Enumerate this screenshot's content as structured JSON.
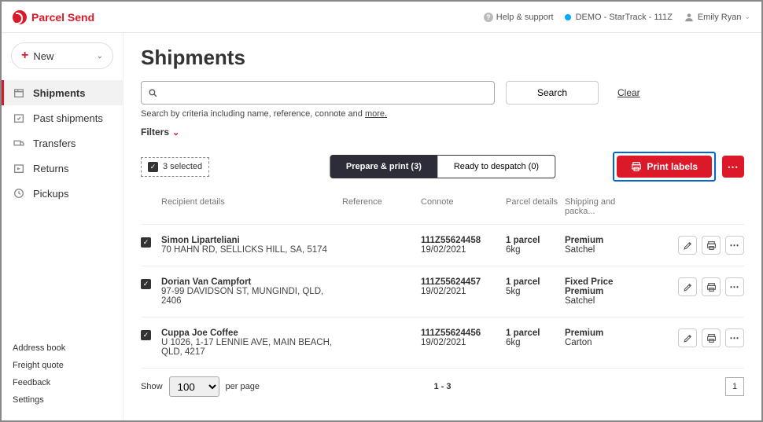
{
  "brand": "Parcel Send",
  "header": {
    "help": "Help & support",
    "org": "DEMO - StarTrack - 111Z",
    "user": "Emily Ryan"
  },
  "sidebar": {
    "new_label": "New",
    "items": [
      {
        "label": "Shipments",
        "active": true
      },
      {
        "label": "Past shipments"
      },
      {
        "label": "Transfers"
      },
      {
        "label": "Returns"
      },
      {
        "label": "Pickups"
      }
    ],
    "bottom": [
      "Address book",
      "Freight quote",
      "Feedback",
      "Settings"
    ]
  },
  "page": {
    "title": "Shipments",
    "search_btn": "Search",
    "clear": "Clear",
    "hint_prefix": "Search by criteria including name, reference, connote and ",
    "hint_more": "more.",
    "filters": "Filters",
    "selected": "3 selected",
    "tabs": {
      "prepare": "Prepare & print (3)",
      "ready": "Ready to despatch (0)"
    },
    "print": "Print labels",
    "columns": {
      "recipient": "Recipient details",
      "reference": "Reference",
      "connote": "Connote",
      "parcel": "Parcel details",
      "shipping": "Shipping and packa..."
    },
    "rows": [
      {
        "name": "Simon Liparteliani",
        "addr": "70 HAHN RD, SELLICKS HILL, SA, 5174",
        "connote": "111Z55624458",
        "date": "19/02/2021",
        "parcels": "1 parcel",
        "weight": "6kg",
        "ship1": "Premium",
        "ship2": "Satchel"
      },
      {
        "name": "Dorian Van Campfort",
        "addr": "97-99 DAVIDSON ST, MUNGINDI, QLD, 2406",
        "connote": "111Z55624457",
        "date": "19/02/2021",
        "parcels": "1 parcel",
        "weight": "5kg",
        "ship1": "Fixed Price Premium",
        "ship2": "Satchel"
      },
      {
        "name": "Cuppa Joe Coffee",
        "addr": "U 1026, 1-17 LENNIE AVE, MAIN BEACH, QLD, 4217",
        "connote": "111Z55624456",
        "date": "19/02/2021",
        "parcels": "1 parcel",
        "weight": "6kg",
        "ship1": "Premium",
        "ship2": "Carton"
      }
    ],
    "pager": {
      "show": "Show",
      "per_page": "per page",
      "page_size": "100",
      "range": "1 - 3",
      "page": "1"
    }
  }
}
